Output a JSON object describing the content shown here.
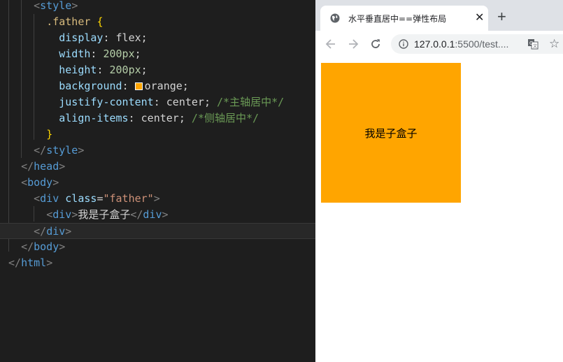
{
  "editor": {
    "lines": [
      {
        "indent": "    ",
        "parts": [
          [
            "punct",
            "<"
          ],
          [
            "tag",
            "style"
          ],
          [
            "punct",
            ">"
          ]
        ]
      },
      {
        "indent": "      ",
        "parts": [
          [
            "sel",
            ".father"
          ],
          [
            "txt",
            " "
          ],
          [
            "brace",
            "{"
          ]
        ]
      },
      {
        "indent": "        ",
        "parts": [
          [
            "prop",
            "display"
          ],
          [
            "txt",
            ": flex;"
          ]
        ]
      },
      {
        "indent": "        ",
        "parts": [
          [
            "prop",
            "width"
          ],
          [
            "txt",
            ": "
          ],
          [
            "num",
            "200px"
          ],
          [
            "txt",
            ";"
          ]
        ]
      },
      {
        "indent": "        ",
        "parts": [
          [
            "prop",
            "height"
          ],
          [
            "txt",
            ": "
          ],
          [
            "num",
            "200px"
          ],
          [
            "txt",
            ";"
          ]
        ]
      },
      {
        "indent": "        ",
        "parts": [
          [
            "prop",
            "background"
          ],
          [
            "txt",
            ": "
          ],
          [
            "swatch",
            ""
          ],
          [
            "txt",
            "orange;"
          ]
        ]
      },
      {
        "indent": "        ",
        "parts": [
          [
            "prop",
            "justify-content"
          ],
          [
            "txt",
            ": center; "
          ],
          [
            "cmt",
            "/*主轴居中*/"
          ]
        ]
      },
      {
        "indent": "        ",
        "parts": [
          [
            "prop",
            "align-items"
          ],
          [
            "txt",
            ": center; "
          ],
          [
            "cmt",
            "/*侧轴居中*/"
          ]
        ]
      },
      {
        "indent": "      ",
        "parts": [
          [
            "brace",
            "}"
          ]
        ]
      },
      {
        "indent": "    ",
        "parts": [
          [
            "punct",
            "</"
          ],
          [
            "tag",
            "style"
          ],
          [
            "punct",
            ">"
          ]
        ]
      },
      {
        "indent": "  ",
        "parts": [
          [
            "punct",
            "</"
          ],
          [
            "tag",
            "head"
          ],
          [
            "punct",
            ">"
          ]
        ]
      },
      {
        "indent": "  ",
        "parts": [
          [
            "punct",
            "<"
          ],
          [
            "tag",
            "body"
          ],
          [
            "punct",
            ">"
          ]
        ]
      },
      {
        "indent": "    ",
        "parts": [
          [
            "punct",
            "<"
          ],
          [
            "tag",
            "div"
          ],
          [
            "txt",
            " "
          ],
          [
            "attr",
            "class"
          ],
          [
            "txt",
            "="
          ],
          [
            "str",
            "\"father\""
          ],
          [
            "punct",
            ">"
          ]
        ]
      },
      {
        "indent": "      ",
        "parts": [
          [
            "punct",
            "<"
          ],
          [
            "tag",
            "div"
          ],
          [
            "punct",
            ">"
          ],
          [
            "txt",
            "我是子盒子"
          ],
          [
            "punct",
            "</"
          ],
          [
            "tag",
            "div"
          ],
          [
            "punct",
            ">"
          ]
        ]
      },
      {
        "indent": "    ",
        "current": true,
        "parts": [
          [
            "punct",
            "</"
          ],
          [
            "tag",
            "div"
          ],
          [
            "punct",
            ">"
          ]
        ]
      },
      {
        "indent": "  ",
        "parts": [
          [
            "punct",
            "</"
          ],
          [
            "tag",
            "body"
          ],
          [
            "punct",
            ">"
          ]
        ]
      },
      {
        "indent": "",
        "parts": [
          [
            "punct",
            "</"
          ],
          [
            "tag",
            "html"
          ],
          [
            "punct",
            ">"
          ]
        ]
      }
    ]
  },
  "browser": {
    "tab_title": "水平垂直居中==弹性布局",
    "tab_close": "✕",
    "new_tab": "+",
    "url_host": "127.0.0.1",
    "url_rest": ":5500/test....",
    "star": "☆"
  },
  "page": {
    "child_text": "我是子盒子",
    "father_color": "#ffa500"
  }
}
